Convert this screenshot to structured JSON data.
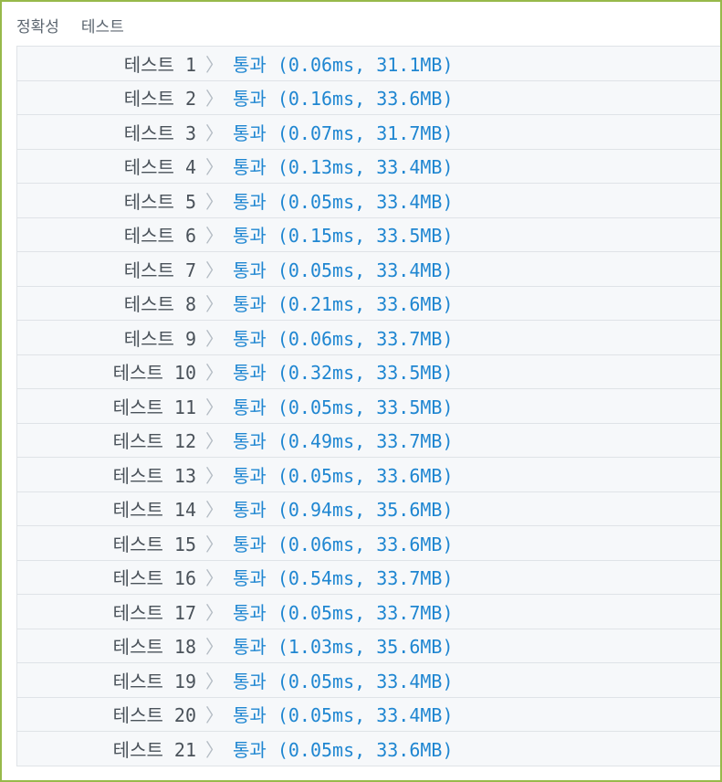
{
  "header": {
    "tab_accuracy": "정확성",
    "tab_test": "테스트"
  },
  "chevron": "〉",
  "tests": [
    {
      "name": "테스트 1",
      "result": "통과 (0.06ms, 31.1MB)"
    },
    {
      "name": "테스트 2",
      "result": "통과 (0.16ms, 33.6MB)"
    },
    {
      "name": "테스트 3",
      "result": "통과 (0.07ms, 31.7MB)"
    },
    {
      "name": "테스트 4",
      "result": "통과 (0.13ms, 33.4MB)"
    },
    {
      "name": "테스트 5",
      "result": "통과 (0.05ms, 33.4MB)"
    },
    {
      "name": "테스트 6",
      "result": "통과 (0.15ms, 33.5MB)"
    },
    {
      "name": "테스트 7",
      "result": "통과 (0.05ms, 33.4MB)"
    },
    {
      "name": "테스트 8",
      "result": "통과 (0.21ms, 33.6MB)"
    },
    {
      "name": "테스트 9",
      "result": "통과 (0.06ms, 33.7MB)"
    },
    {
      "name": "테스트 10",
      "result": "통과 (0.32ms, 33.5MB)"
    },
    {
      "name": "테스트 11",
      "result": "통과 (0.05ms, 33.5MB)"
    },
    {
      "name": "테스트 12",
      "result": "통과 (0.49ms, 33.7MB)"
    },
    {
      "name": "테스트 13",
      "result": "통과 (0.05ms, 33.6MB)"
    },
    {
      "name": "테스트 14",
      "result": "통과 (0.94ms, 35.6MB)"
    },
    {
      "name": "테스트 15",
      "result": "통과 (0.06ms, 33.6MB)"
    },
    {
      "name": "테스트 16",
      "result": "통과 (0.54ms, 33.7MB)"
    },
    {
      "name": "테스트 17",
      "result": "통과 (0.05ms, 33.7MB)"
    },
    {
      "name": "테스트 18",
      "result": "통과 (1.03ms, 35.6MB)"
    },
    {
      "name": "테스트 19",
      "result": "통과 (0.05ms, 33.4MB)"
    },
    {
      "name": "테스트 20",
      "result": "통과 (0.05ms, 33.4MB)"
    },
    {
      "name": "테스트 21",
      "result": "통과 (0.05ms, 33.6MB)"
    }
  ],
  "colors": {
    "frame_border": "#97b94a",
    "pass_text": "#1f86d1",
    "row_bg": "#f6f8fa"
  }
}
